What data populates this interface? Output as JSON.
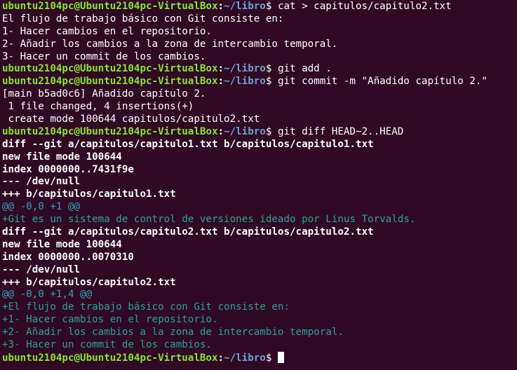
{
  "prompt": {
    "user_host": "ubuntu2104pc@Ubuntu2104pc-VirtualBox",
    "colon": ":",
    "path": "~/libro",
    "dollar": "$ "
  },
  "lines": [
    {
      "kind": "prompt",
      "cmd": "cat > capitulos/capitulo2.txt"
    },
    {
      "kind": "plain",
      "text": "El flujo de trabajo básico con Git consiste en:"
    },
    {
      "kind": "plain",
      "text": "1- Hacer cambios en el repositorio."
    },
    {
      "kind": "plain",
      "text": "2- Añadir los cambios a la zona de intercambio temporal."
    },
    {
      "kind": "plain",
      "text": "3- Hacer un commit de los cambios."
    },
    {
      "kind": "prompt",
      "cmd": "git add ."
    },
    {
      "kind": "prompt",
      "cmd": "git commit -m \"Añadido capítulo 2.\""
    },
    {
      "kind": "plain",
      "text": "[main b5ad0c6] Añadido capítulo 2."
    },
    {
      "kind": "plain",
      "text": " 1 file changed, 4 insertions(+)"
    },
    {
      "kind": "plain",
      "text": " create mode 100644 capitulos/capitulo2.txt"
    },
    {
      "kind": "prompt",
      "cmd": "git diff HEAD~2..HEAD"
    },
    {
      "kind": "bold",
      "text": "diff --git a/capitulos/capitulo1.txt b/capitulos/capitulo1.txt"
    },
    {
      "kind": "bold",
      "text": "new file mode 100644"
    },
    {
      "kind": "bold",
      "text": "index 0000000..7431f9e"
    },
    {
      "kind": "bold",
      "text": "--- /dev/null"
    },
    {
      "kind": "bold",
      "text": "+++ b/capitulos/capitulo1.txt"
    },
    {
      "kind": "hunk",
      "text": "@@ -0,0 +1 @@"
    },
    {
      "kind": "add",
      "text": "+Git es un sistema de control de versiones ideado por Linus Torvalds."
    },
    {
      "kind": "bold",
      "text": "diff --git a/capitulos/capitulo2.txt b/capitulos/capitulo2.txt"
    },
    {
      "kind": "bold",
      "text": "new file mode 100644"
    },
    {
      "kind": "bold",
      "text": "index 0000000..0070310"
    },
    {
      "kind": "bold",
      "text": "--- /dev/null"
    },
    {
      "kind": "bold",
      "text": "+++ b/capitulos/capitulo2.txt"
    },
    {
      "kind": "hunk",
      "text": "@@ -0,0 +1,4 @@"
    },
    {
      "kind": "add",
      "text": "+El flujo de trabajo básico con Git consiste en:"
    },
    {
      "kind": "add",
      "text": "+1- Hacer cambios en el repositorio."
    },
    {
      "kind": "add",
      "text": "+2- Añadir los cambios a la zona de intercambio temporal."
    },
    {
      "kind": "add",
      "text": "+3- Hacer un commit de los cambios."
    },
    {
      "kind": "prompt-cursor",
      "cmd": ""
    }
  ],
  "colors": {
    "background": "#300a24",
    "user_host": "#8ae234",
    "path": "#729fcf",
    "diff_hunk": "#34a0b8",
    "diff_add": "#2aa198"
  }
}
